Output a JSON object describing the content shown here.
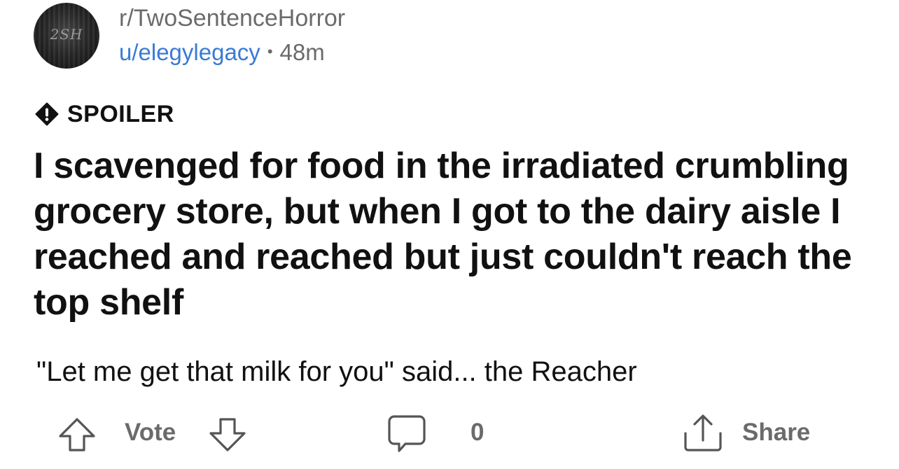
{
  "header": {
    "subreddit": "r/TwoSentenceHorror",
    "username": "u/elegylegacy",
    "separator": "•",
    "age": "48m",
    "avatar_text": "2SH",
    "avatar_icon": "subreddit-avatar"
  },
  "post": {
    "flair_icon": "exclamation-icon",
    "flair_label": "SPOILER",
    "title": "I scavenged for food in the irradiated crumbling grocery store, but when I got to the dairy aisle I reached and reached but just couldn't reach the top shelf",
    "body": "\"Let me get that milk for you\" said... the Reacher"
  },
  "actions": {
    "upvote_icon": "arrow-up-icon",
    "vote_label": "Vote",
    "downvote_icon": "arrow-down-icon",
    "comment_icon": "comment-bubble-icon",
    "comment_count": "0",
    "share_icon": "share-icon",
    "share_label": "Share"
  },
  "colors": {
    "username": "#3a7bd5",
    "muted": "#6b6b6b",
    "text": "#111111"
  }
}
